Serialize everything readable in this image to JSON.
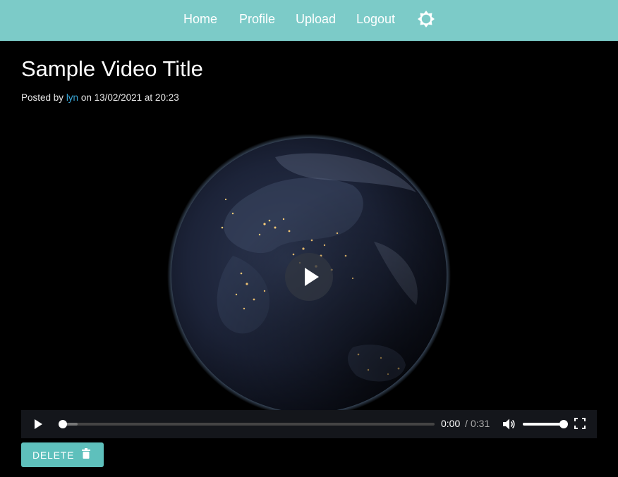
{
  "nav": {
    "links": [
      {
        "label": "Home"
      },
      {
        "label": "Profile"
      },
      {
        "label": "Upload"
      },
      {
        "label": "Logout"
      }
    ],
    "theme_toggle_icon": "brightness-icon"
  },
  "video": {
    "title": "Sample Video Title",
    "posted_by_prefix": "Posted by",
    "author": "lyn",
    "date_text": "on 13/02/2021 at 20:23",
    "poster_description_icon": "earth-at-night-image",
    "player": {
      "current_time": "0:00",
      "separator": "/",
      "duration": "0:31",
      "progress_fraction": 0,
      "volume_fraction": 1.0
    }
  },
  "actions": {
    "delete_label": "DELETE",
    "delete_icon": "trash-icon"
  },
  "colors": {
    "navbar": "#7ccbc8",
    "button": "#5ec0bc",
    "author_link": "#3aa8d8",
    "background": "#000000"
  }
}
